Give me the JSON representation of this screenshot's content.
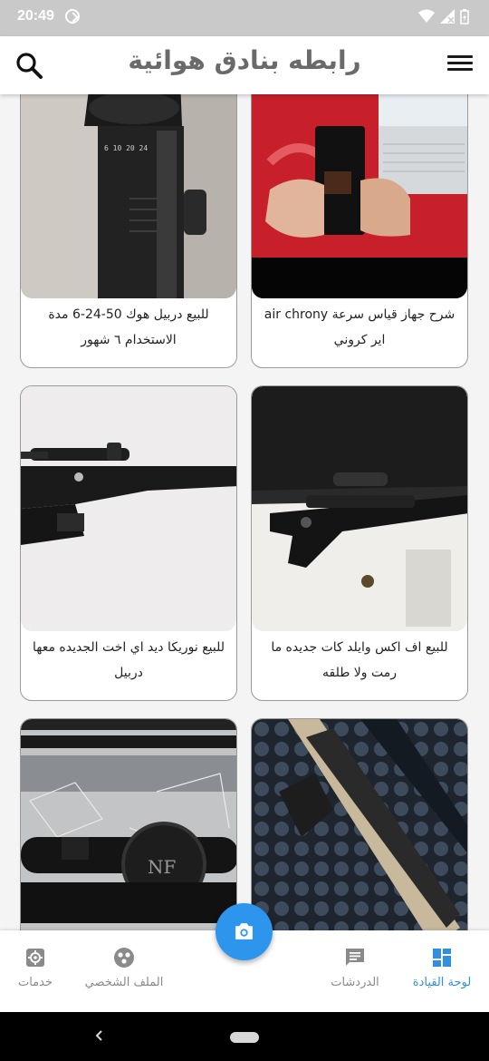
{
  "status_bar": {
    "time": "20:49"
  },
  "app_bar": {
    "title": "رابطه بنادق هوائية",
    "search_icon": "search-icon",
    "menu_icon": "menu-icon"
  },
  "listings": [
    {
      "caption": "شرح جهاز قياس سرعة air chrony اير كروني",
      "image": "chronograph-device-photo"
    },
    {
      "caption": "للبيع دربيل هوك 50-24-6 مدة الاستخدام ٦ شهور",
      "image": "rifle-scope-photo"
    },
    {
      "caption": "للبيع اف اكس وايلد كات جديده ما رمت ولا طلقه",
      "image": "air-rifle-in-case-photo"
    },
    {
      "caption": "للبيع نوريكا ديد اي اخت الجديده معها دربيل",
      "image": "air-rifle-with-scope-photo"
    },
    {
      "caption": "",
      "image": "rifle-in-foam-case-photo"
    },
    {
      "caption": "",
      "image": "scope-on-rifle-photo"
    }
  ],
  "bottom_nav": {
    "dashboard": {
      "label": "لوحة القيادة",
      "icon": "dashboard-icon"
    },
    "chats": {
      "label": "الدردشات",
      "icon": "chat-icon"
    },
    "camera": {
      "icon": "camera-icon"
    },
    "profile": {
      "label": "الملف الشخصي",
      "icon": "profile-icon"
    },
    "services": {
      "label": "خدمات",
      "icon": "gear-icon"
    }
  },
  "colors": {
    "accent": "#2D96EC",
    "title_gray": "#6A6A6A",
    "status_bar": "#C9C9C9"
  }
}
